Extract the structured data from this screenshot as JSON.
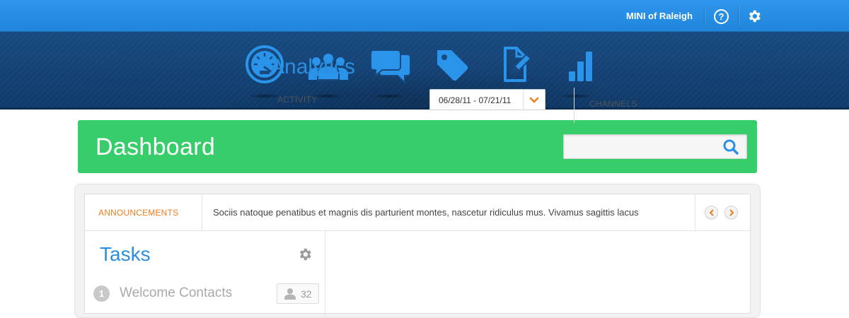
{
  "header": {
    "account_name": "MINI of Raleigh",
    "help_label": "?",
    "brand_color": "#2a8fe6"
  },
  "nav": {
    "items": [
      {
        "icon": "speedometer-icon",
        "label": "dashboard"
      },
      {
        "icon": "people-icon",
        "label": "contacts"
      },
      {
        "icon": "chat-bubbles-icon",
        "label": "messages"
      },
      {
        "icon": "tag-icon",
        "label": "offers"
      },
      {
        "icon": "document-edit-icon",
        "label": "content"
      },
      {
        "icon": "bar-chart-icon",
        "label": "analytics"
      }
    ],
    "active_index": 0,
    "icon_color": "#2a93ea"
  },
  "dashboard": {
    "title": "Dashboard",
    "accent": "#37cd6a",
    "search": {
      "value": "",
      "placeholder": ""
    }
  },
  "announcements": {
    "label": "ANNOUNCEMENTS",
    "text": "Sociis natoque penatibus et magnis dis parturient montes, nascetur ridiculus mus. Vivamus sagittis lacus",
    "label_color": "#ef7d1b"
  },
  "tasks": {
    "title": "Tasks",
    "items": [
      {
        "number": "1",
        "name": "Welcome Contacts",
        "count": "32"
      }
    ]
  },
  "analytics": {
    "title": "Analytics",
    "activity_label": "ACTIVITY",
    "date_range": "06/28/11 - 07/21/11",
    "channels_label": "CHANNELS"
  }
}
